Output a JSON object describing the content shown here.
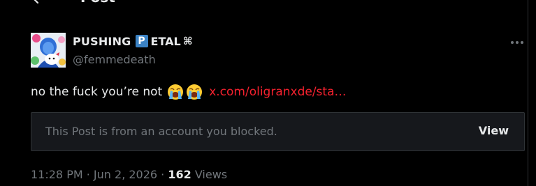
{
  "header": {
    "title": "Post"
  },
  "tweet": {
    "display_name": "PUSHING",
    "badge_letter": "P",
    "display_name_rest": "ETAL",
    "name_symbol": "⌘",
    "handle": "@femmedeath",
    "text": "no the fuck you’re not",
    "emoji_name": "loudly-crying-face",
    "link": "x.com/oligranxde/sta…",
    "blocked_notice": "This Post is from an account you blocked.",
    "view_label": "View",
    "time": "11:28 PM",
    "sep1": " · ",
    "date": "Jun 2, 2026",
    "sep2": " · ",
    "views_count": "162",
    "views_label": " Views"
  },
  "colors": {
    "background": "#000000",
    "link": "#f4212e",
    "muted": "#71767b",
    "badge": "#3b82c4"
  }
}
